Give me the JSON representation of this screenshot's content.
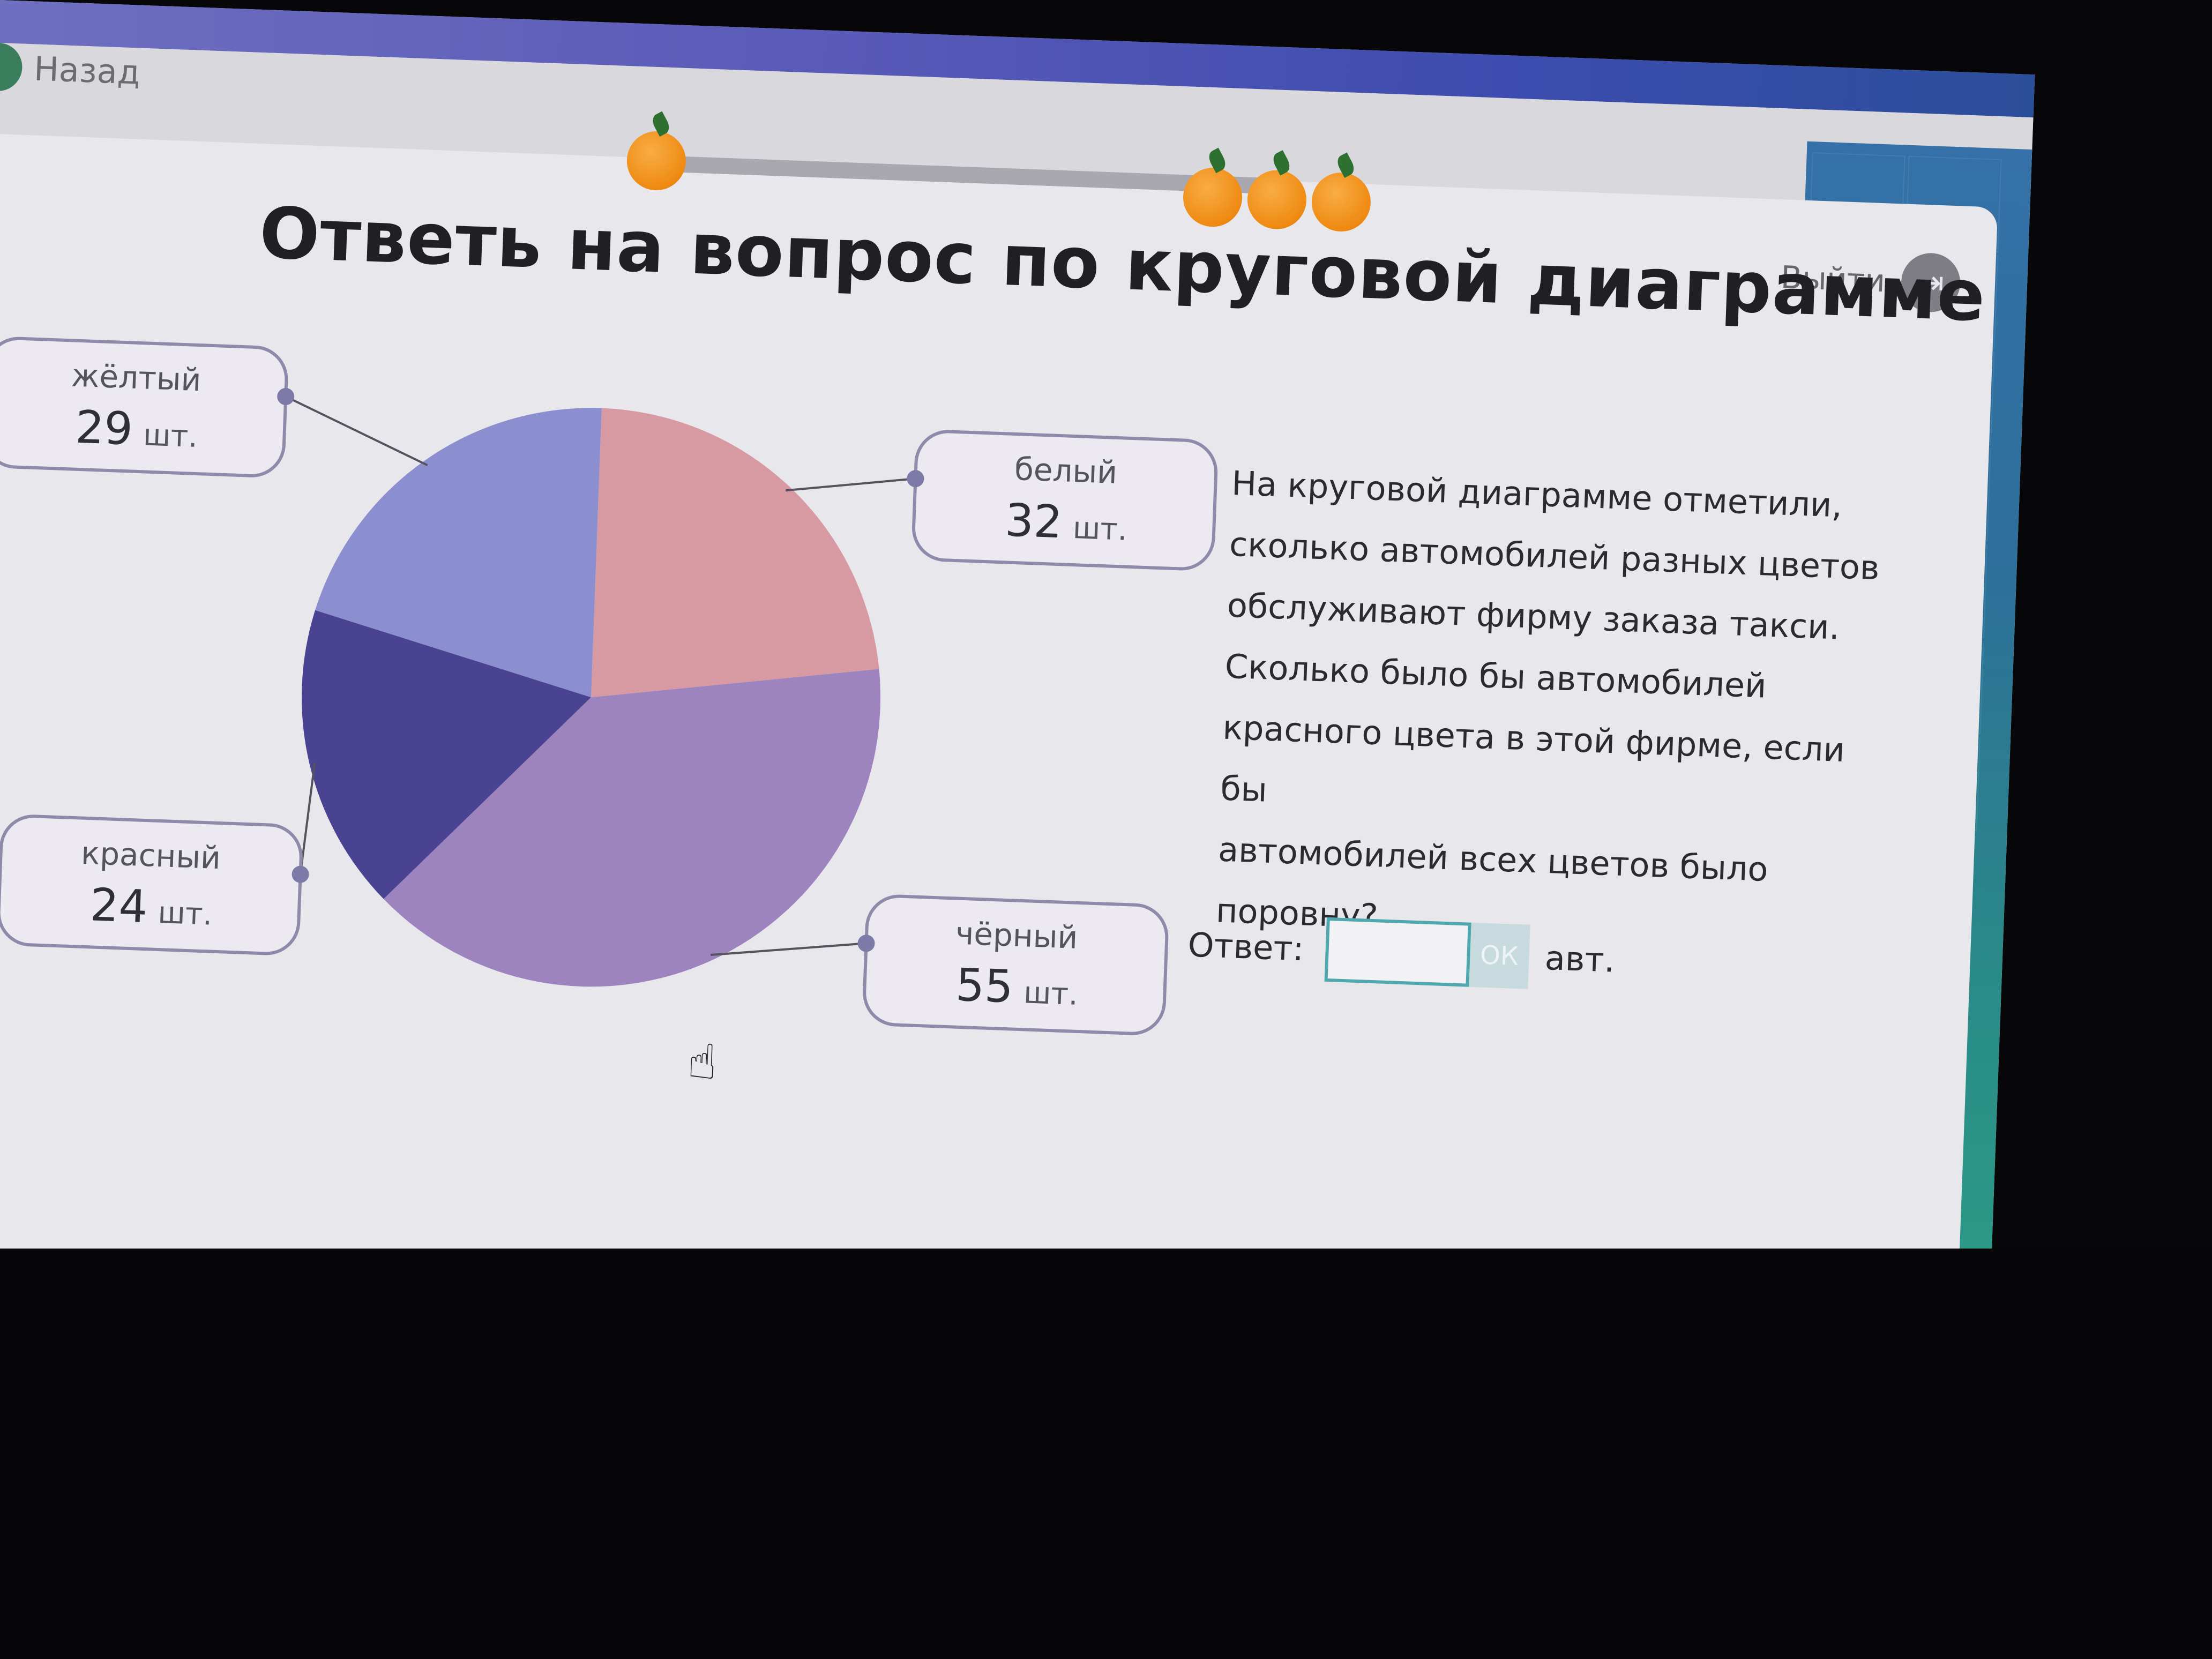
{
  "nav": {
    "back_label": "Назад",
    "exit_label": "Выйти"
  },
  "progress": {
    "collected": 1,
    "remaining": 3
  },
  "title": "Ответь на вопрос по круговой диаграмме",
  "chart_data": {
    "type": "pie",
    "slices": [
      {
        "label": "белый",
        "value": 32,
        "unit": "шт.",
        "color": "#d79aa3"
      },
      {
        "label": "чёрный",
        "value": 55,
        "unit": "шт.",
        "color": "#9d84bf"
      },
      {
        "label": "красный",
        "value": 24,
        "unit": "шт.",
        "color": "#4a4392"
      },
      {
        "label": "жёлтый",
        "value": 29,
        "unit": "шт.",
        "color": "#8b8fcf"
      }
    ]
  },
  "question": {
    "lines": [
      "На круговой диаграмме отметили,",
      "сколько автомобилей разных цветов",
      "обслуживают фирму заказа такси.",
      "Сколько было бы автомобилей",
      "красного цвета в этой фирме, если бы",
      "автомобилей всех цветов было",
      "поровну?"
    ]
  },
  "answer": {
    "label": "Ответ:",
    "value": "",
    "ok_label": "ОК",
    "unit": "авт."
  },
  "colors": {
    "accent": "#4fa8b0",
    "callout_border": "#8f8aaa"
  }
}
